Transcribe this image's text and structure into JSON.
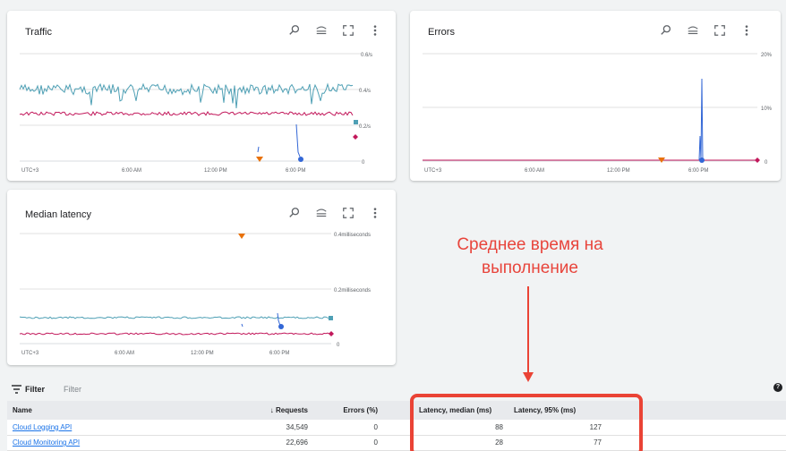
{
  "cards": {
    "traffic": {
      "title": "Traffic",
      "y_ticks": [
        "0.6/s",
        "0.4/s",
        "0.2/s",
        "0"
      ],
      "x_ticks": [
        "UTC+3",
        "6:00 AM",
        "12:00 PM",
        "6:00 PM"
      ]
    },
    "errors": {
      "title": "Errors",
      "y_ticks": [
        "20%",
        "10%",
        "0"
      ],
      "x_ticks": [
        "UTC+3",
        "6:00 AM",
        "12:00 PM",
        "6:00 PM"
      ]
    },
    "latency": {
      "title": "Median latency",
      "y_ticks": [
        "0.4milliseconds",
        "0.2milliseconds",
        "0"
      ],
      "x_ticks": [
        "UTC+3",
        "6:00 AM",
        "12:00 PM",
        "6:00 PM"
      ]
    }
  },
  "toolbar_icons": [
    "reset-zoom-icon",
    "compare-icon",
    "fullscreen-icon",
    "more-vert-icon"
  ],
  "colors": {
    "series_teal": "#4fa0b5",
    "series_magenta": "#c2185b",
    "series_blue": "#3367d6",
    "marker_orange": "#e8710a",
    "annotation_red": "#ea4335"
  },
  "annotation": {
    "line1": "Среднее время на",
    "line2": "выполнение"
  },
  "filter": {
    "label": "Filter",
    "placeholder": "Filter"
  },
  "table": {
    "headers": {
      "name": "Name",
      "requests": "Requests",
      "errors": "Errors (%)",
      "latency_median": "Latency, median (ms)",
      "latency_95": "Latency, 95% (ms)"
    },
    "rows": [
      {
        "name": "Cloud Logging API",
        "requests": "34,549",
        "errors": "0",
        "latency_median": "88",
        "latency_95": "127"
      },
      {
        "name": "Cloud Monitoring API",
        "requests": "22,696",
        "errors": "0",
        "latency_median": "28",
        "latency_95": "77"
      }
    ]
  }
}
